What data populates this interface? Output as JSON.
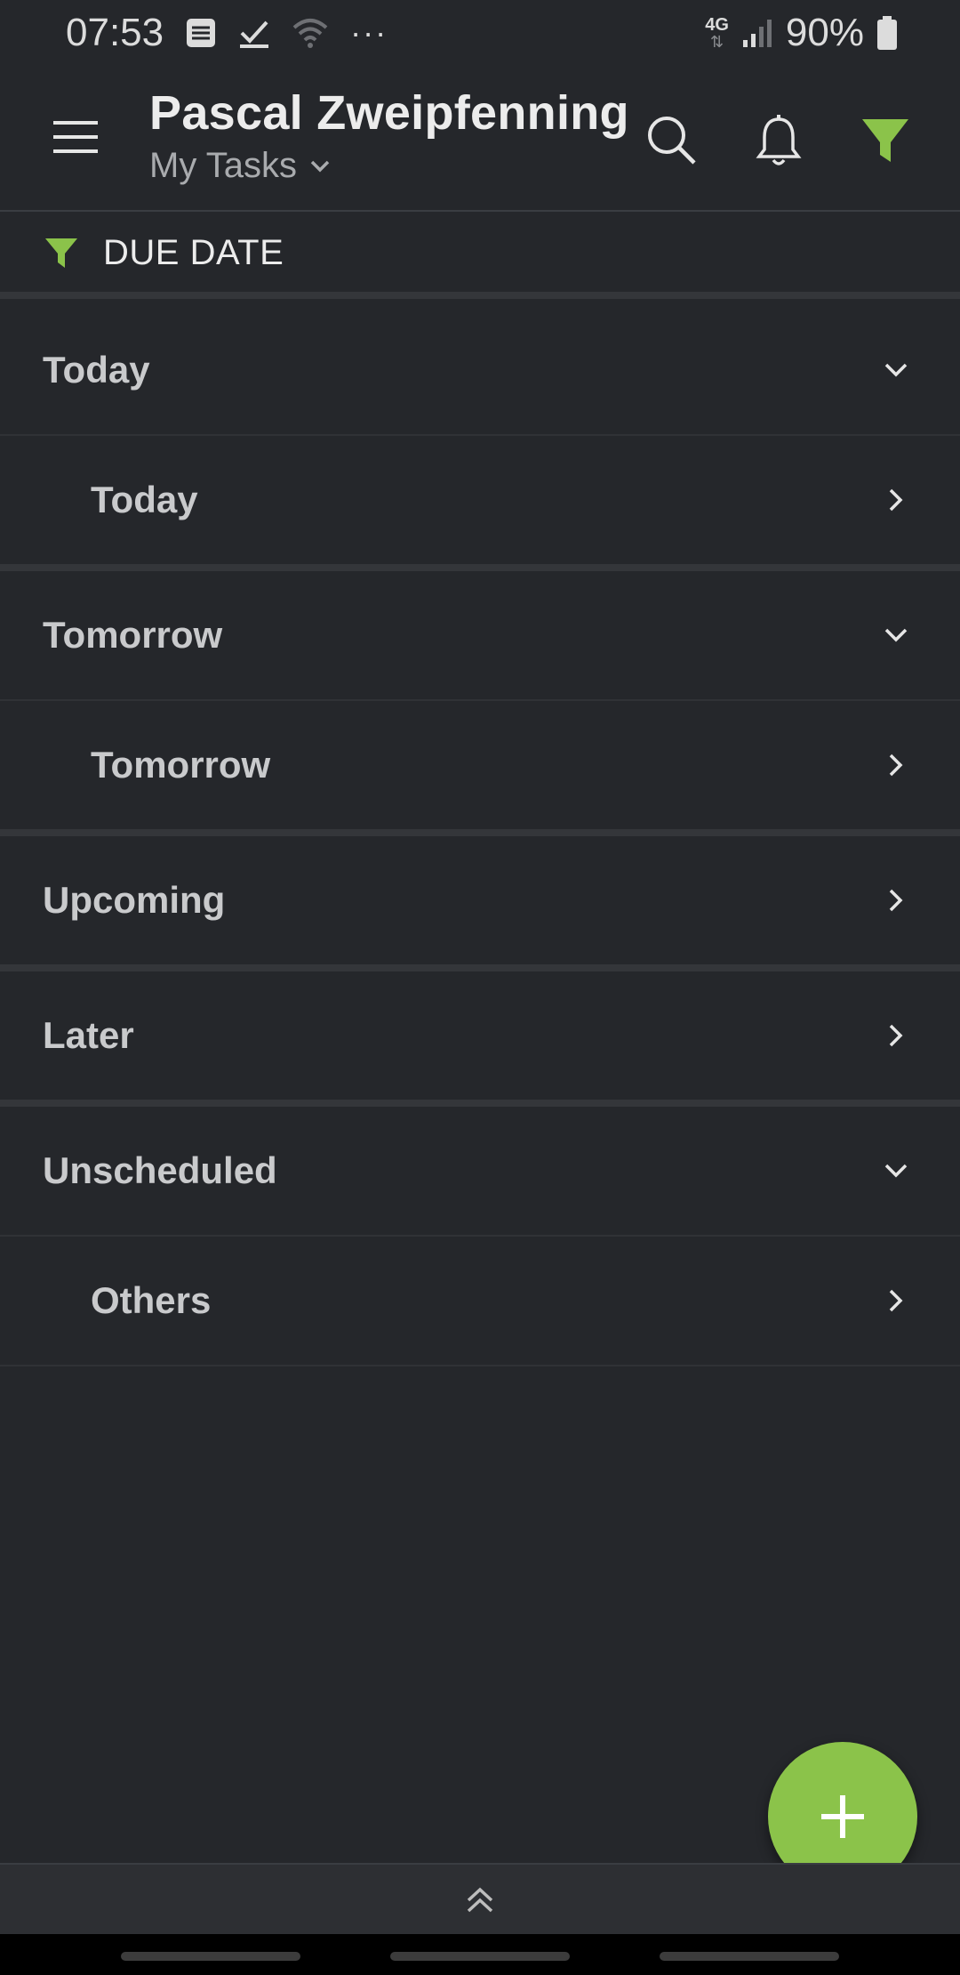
{
  "status_bar": {
    "time": "07:53",
    "network": "4G",
    "battery": "90%",
    "more": "···"
  },
  "app_bar": {
    "title": "Pascal Zweipfenning",
    "subtitle": "My Tasks"
  },
  "filter": {
    "label": "DUE DATE",
    "accent_color": "#8bc34a"
  },
  "list": {
    "today_header": "Today",
    "today_child": "Today",
    "tomorrow_header": "Tomorrow",
    "tomorrow_child": "Tomorrow",
    "upcoming": "Upcoming",
    "later": "Later",
    "unscheduled_header": "Unscheduled",
    "unscheduled_child": "Others"
  },
  "colors": {
    "background": "#25272b",
    "accent": "#8bc34a"
  },
  "icons": {
    "menu": "hamburger-menu-icon",
    "search": "search-icon",
    "notifications": "bell-icon",
    "filter": "filter-icon",
    "add": "plus-icon",
    "expand_bottom": "double-chevron-up-icon"
  }
}
